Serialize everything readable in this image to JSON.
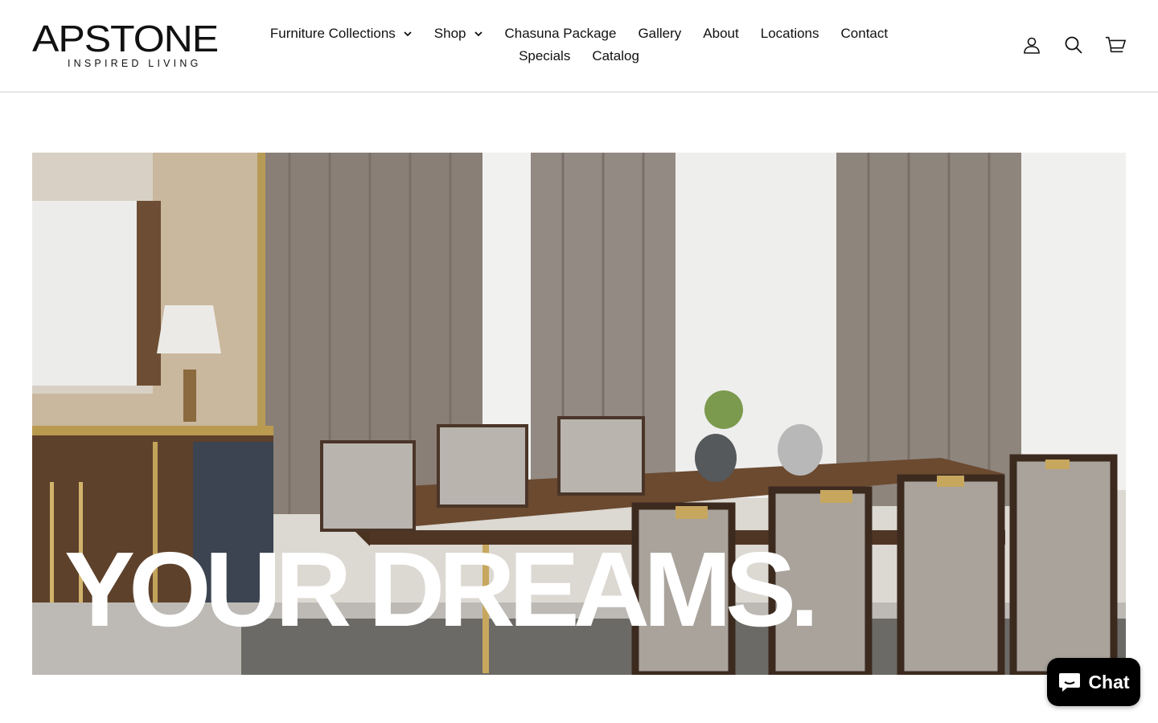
{
  "brand": {
    "name": "APSTONE",
    "tagline": "INSPIRED LIVING"
  },
  "nav": {
    "row1": [
      {
        "label": "Furniture Collections",
        "has_dropdown": true
      },
      {
        "label": "Shop",
        "has_dropdown": true
      },
      {
        "label": "Chasuna Package",
        "has_dropdown": false
      },
      {
        "label": "Gallery",
        "has_dropdown": false
      },
      {
        "label": "About",
        "has_dropdown": false
      },
      {
        "label": "Locations",
        "has_dropdown": false
      },
      {
        "label": "Contact",
        "has_dropdown": false
      }
    ],
    "row2": [
      {
        "label": "Specials",
        "has_dropdown": false
      },
      {
        "label": "Catalog",
        "has_dropdown": false
      }
    ]
  },
  "header_icons": [
    "account-icon",
    "search-icon",
    "cart-icon"
  ],
  "hero": {
    "headline": "YOUR DREAMS.",
    "image": "dining-room-photo"
  },
  "chat": {
    "label": "Chat",
    "color": "#000000"
  }
}
